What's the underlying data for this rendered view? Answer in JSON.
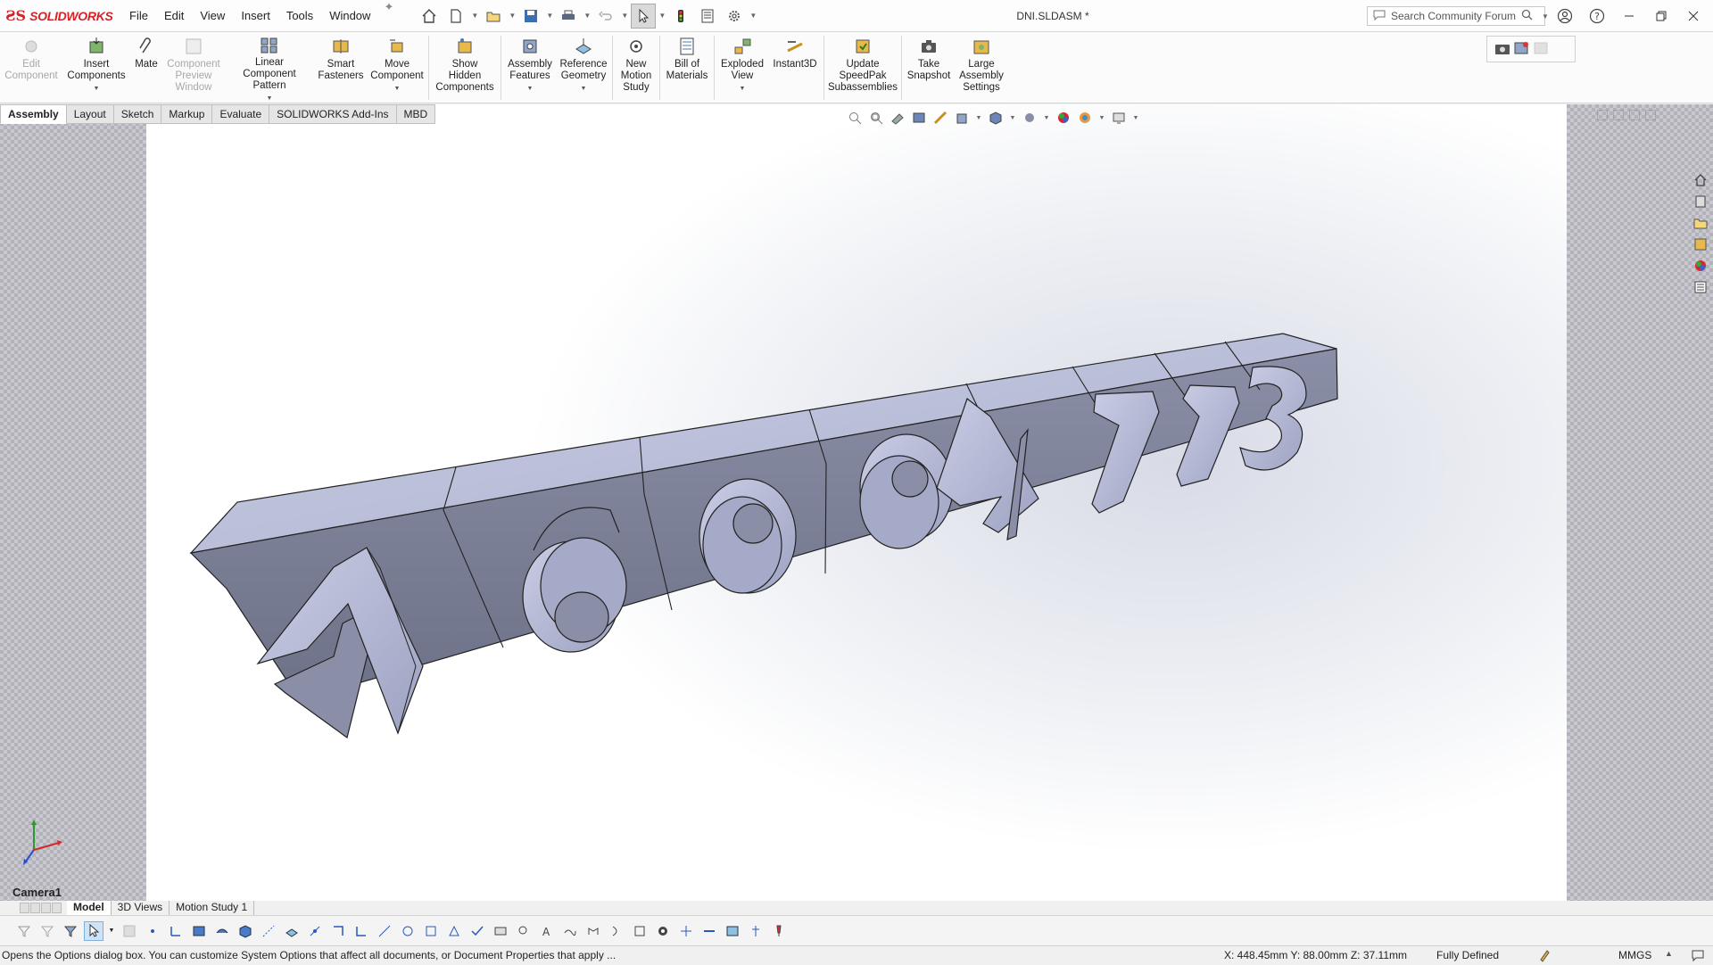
{
  "app": {
    "logo_text": "SOLIDWORKS",
    "window_title": "DNI.SLDASM *",
    "menu": [
      "File",
      "Edit",
      "View",
      "Insert",
      "Tools",
      "Window"
    ],
    "search_placeholder": "Search Community Forum"
  },
  "ribbon": {
    "edit_component": "Edit Component",
    "insert_components": "Insert Components",
    "mate": "Mate",
    "component_preview": "Component Preview Window",
    "linear_pattern": "Linear Component Pattern",
    "smart_fasteners": "Smart Fasteners",
    "move_component": "Move Component",
    "show_hidden": "Show Hidden Components",
    "assembly_features": "Assembly Features",
    "reference_geometry": "Reference Geometry",
    "new_motion_study": "New Motion Study",
    "bill_of_materials": "Bill of Materials",
    "exploded_view": "Exploded View",
    "instant3d": "Instant3D",
    "update_speedpak": "Update SpeedPak Subassemblies",
    "take_snapshot": "Take Snapshot",
    "large_assembly": "Large Assembly Settings"
  },
  "tabs": [
    "Assembly",
    "Layout",
    "Sketch",
    "Markup",
    "Evaluate",
    "SOLIDWORKS Add-Ins",
    "MBD"
  ],
  "viewport": {
    "digits": [
      "1",
      "6",
      "9",
      "9",
      "4",
      "7",
      "7",
      "3"
    ],
    "camera_label": "Camera1",
    "triad_colors": {
      "x": "#d42a2a",
      "y": "#2a9a2a",
      "z": "#2a4ad4"
    }
  },
  "bottom_tabs": [
    "Model",
    "3D Views",
    "Motion Study 1"
  ],
  "status": {
    "message": "Opens the Options dialog box. You can customize System Options that affect all documents, or Document Properties that apply ...",
    "coords": "X: 448.45mm Y: 88.00mm Z: 37.11mm",
    "state": "Fully Defined",
    "units": "MMGS"
  },
  "colors": {
    "brand": "#d2232a",
    "model_face": "#b4b8d2",
    "model_dark": "#7c8098"
  }
}
